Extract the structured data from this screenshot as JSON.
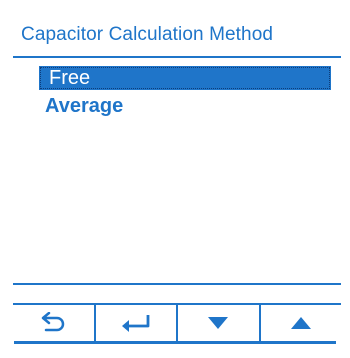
{
  "screen": {
    "title": "Capacitor Calculation Method",
    "options": [
      {
        "label": "Free",
        "selected": true
      },
      {
        "label": "Average",
        "selected": false
      }
    ],
    "status_text": ""
  },
  "softkeys": [
    {
      "icon": "back-arrow-icon"
    },
    {
      "icon": "enter-icon"
    },
    {
      "icon": "down-triangle-icon"
    },
    {
      "icon": "up-triangle-icon"
    }
  ],
  "colors": {
    "accent": "#1f75c9",
    "background": "#ffffff"
  }
}
